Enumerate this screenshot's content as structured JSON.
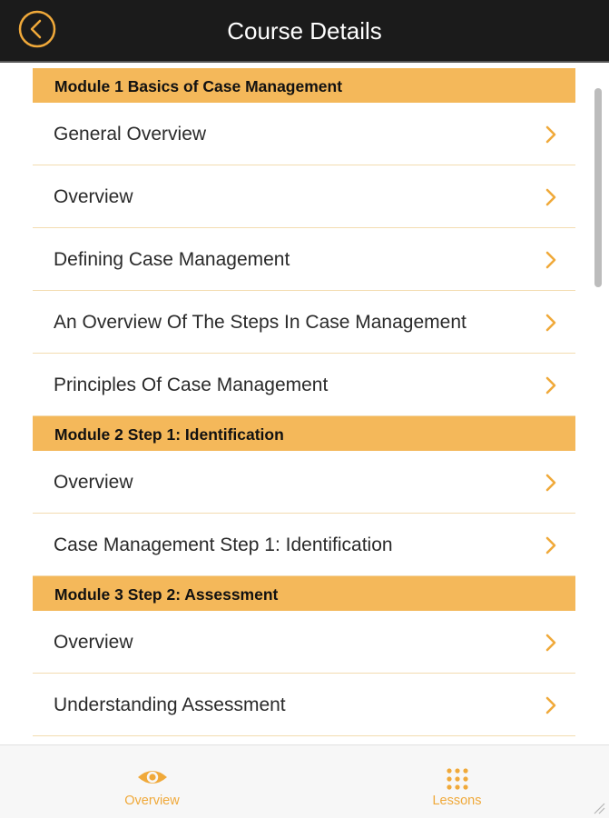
{
  "header": {
    "title": "Course Details",
    "back_icon": "back-circle-icon"
  },
  "colors": {
    "accent": "#f4b85a",
    "chevron": "#f0a93a",
    "topbar": "#1b1b1b"
  },
  "modules": [
    {
      "title": "Module 1 Basics of Case Management",
      "lessons": [
        "General Overview",
        "Overview",
        "Defining Case Management",
        "An Overview Of The Steps In Case Management",
        "Principles Of Case Management"
      ]
    },
    {
      "title": "Module 2 Step 1: Identification",
      "lessons": [
        "Overview",
        "Case Management Step 1: Identification"
      ]
    },
    {
      "title": "Module 3 Step 2: Assessment",
      "lessons": [
        "Overview",
        "Understanding Assessment"
      ]
    }
  ],
  "tabs": [
    {
      "label": "Overview",
      "icon": "eye-icon"
    },
    {
      "label": "Lessons",
      "icon": "grid-icon"
    }
  ]
}
